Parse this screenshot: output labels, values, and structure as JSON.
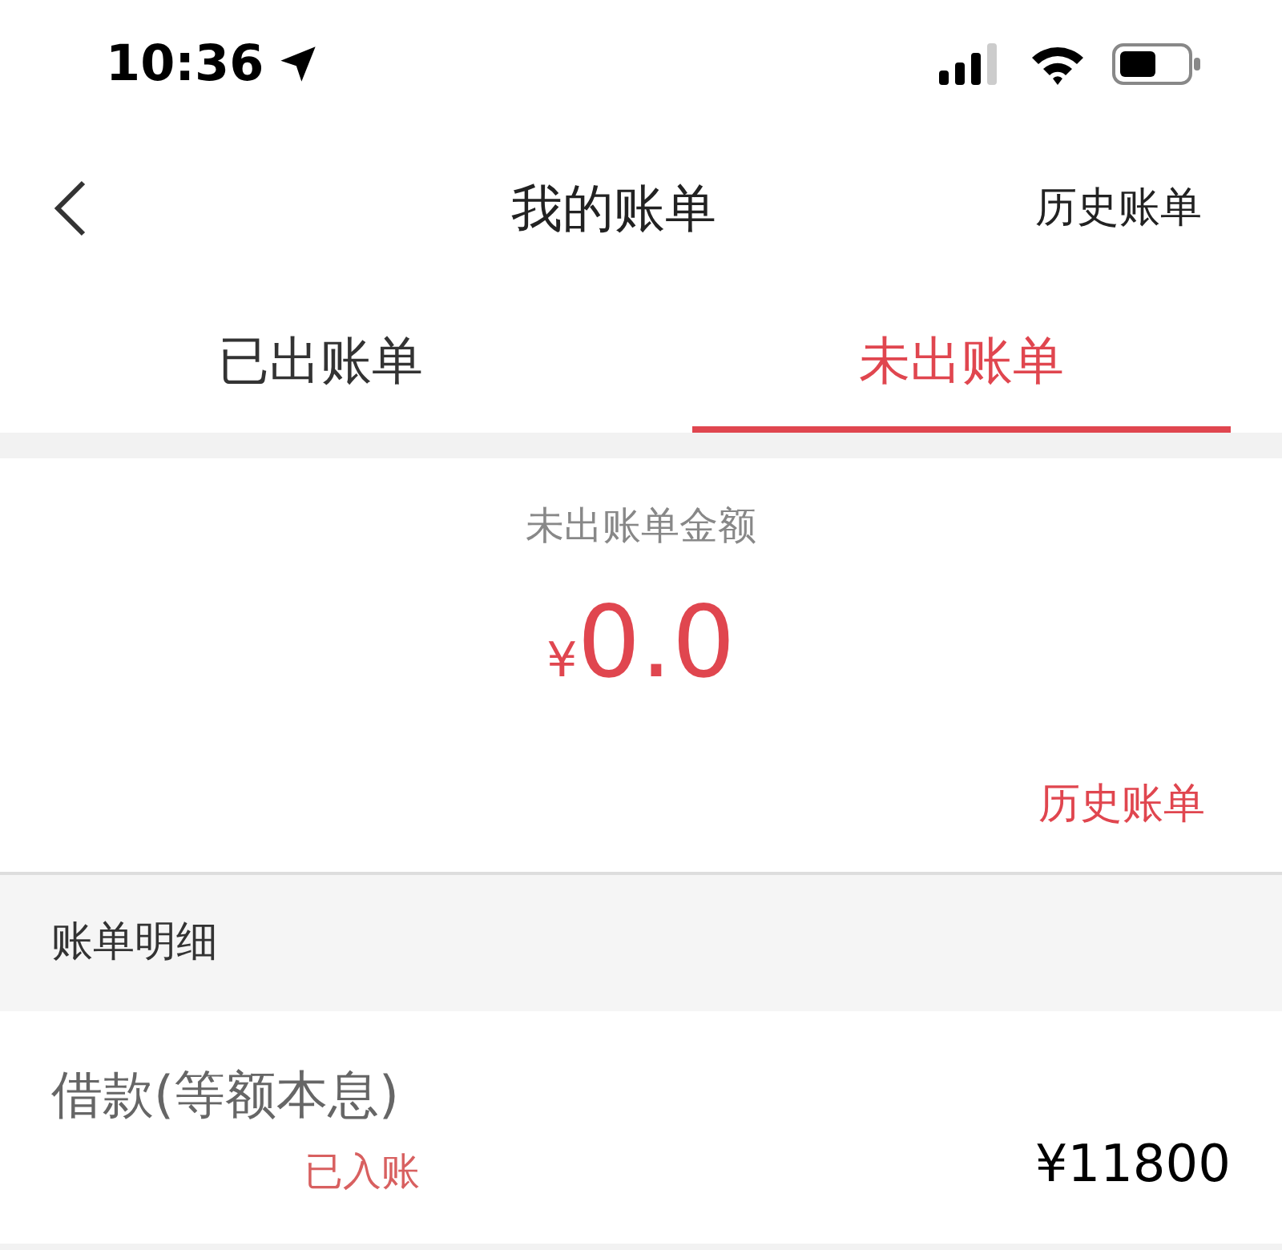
{
  "status_bar": {
    "time": "10:36"
  },
  "nav": {
    "title": "我的账单",
    "action": "历史账单"
  },
  "tabs": [
    {
      "label": "已出账单",
      "selected": false
    },
    {
      "label": "未出账单",
      "selected": true
    }
  ],
  "summary": {
    "label": "未出账单金额",
    "currency": "¥",
    "amount": "0.0",
    "link": "历史账单"
  },
  "section": {
    "title": "账单明细"
  },
  "items": [
    {
      "title": "借款(等额本息)",
      "status": "已入账",
      "amount": "¥11800"
    }
  ]
}
